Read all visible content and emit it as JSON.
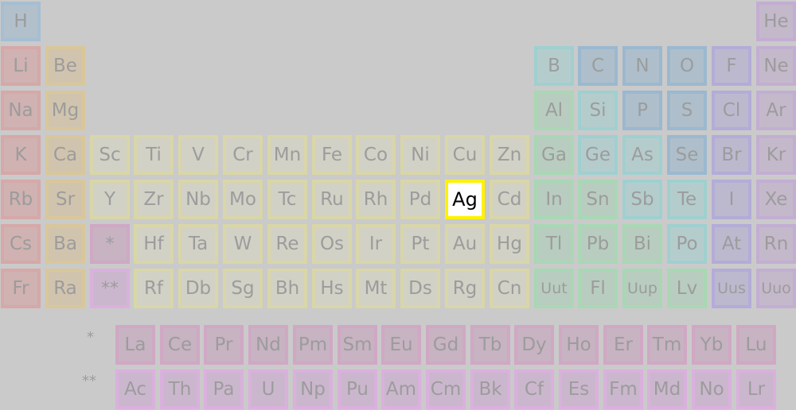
{
  "title": "",
  "selected": "Ag",
  "colors": {
    "background": "#cacaca",
    "text": "#9c9c9c",
    "selected_bg": "#ffffff",
    "selected_border": "#fff200",
    "selected_text": "#000000",
    "families": {
      "alkali": {
        "bg": "#cfb2b1",
        "border": "#d6a8a8"
      },
      "alkaline": {
        "bg": "#d1c4ae",
        "border": "#d9c79a"
      },
      "transition": {
        "bg": "#d1d1c6",
        "border": "#d9d6a8"
      },
      "lanthanide": {
        "bg": "#c7b3c2",
        "border": "#d0a8c4"
      },
      "actinide": {
        "bg": "#cbb7cd",
        "border": "#dab0dd"
      },
      "poor": {
        "bg": "#b8cdbf",
        "border": "#a8d8b4"
      },
      "metalloid": {
        "bg": "#b5cccd",
        "border": "#9fd0d0"
      },
      "nonmetal": {
        "bg": "#aebfcb",
        "border": "#9bb8cf"
      },
      "halogen": {
        "bg": "#bcb9cf",
        "border": "#b3acd8"
      },
      "noble": {
        "bg": "#c4b9ca",
        "border": "#c3aed3"
      },
      "hydrogen": {
        "bg": "#b2c0cb",
        "border": "#a5bed2"
      }
    }
  },
  "markers": [
    "*",
    "**"
  ],
  "rows": [
    [
      {
        "s": "H",
        "f": "hydrogen"
      },
      null,
      null,
      null,
      null,
      null,
      null,
      null,
      null,
      null,
      null,
      null,
      null,
      null,
      null,
      null,
      null,
      {
        "s": "He",
        "f": "noble"
      }
    ],
    [
      {
        "s": "Li",
        "f": "alkali"
      },
      {
        "s": "Be",
        "f": "alkaline"
      },
      null,
      null,
      null,
      null,
      null,
      null,
      null,
      null,
      null,
      null,
      {
        "s": "B",
        "f": "metalloid"
      },
      {
        "s": "C",
        "f": "nonmetal"
      },
      {
        "s": "N",
        "f": "nonmetal"
      },
      {
        "s": "O",
        "f": "nonmetal"
      },
      {
        "s": "F",
        "f": "halogen"
      },
      {
        "s": "Ne",
        "f": "noble"
      }
    ],
    [
      {
        "s": "Na",
        "f": "alkali"
      },
      {
        "s": "Mg",
        "f": "alkaline"
      },
      null,
      null,
      null,
      null,
      null,
      null,
      null,
      null,
      null,
      null,
      {
        "s": "Al",
        "f": "poor"
      },
      {
        "s": "Si",
        "f": "metalloid"
      },
      {
        "s": "P",
        "f": "nonmetal"
      },
      {
        "s": "S",
        "f": "nonmetal"
      },
      {
        "s": "Cl",
        "f": "halogen"
      },
      {
        "s": "Ar",
        "f": "noble"
      }
    ],
    [
      {
        "s": "K",
        "f": "alkali"
      },
      {
        "s": "Ca",
        "f": "alkaline"
      },
      {
        "s": "Sc",
        "f": "transition"
      },
      {
        "s": "Ti",
        "f": "transition"
      },
      {
        "s": "V",
        "f": "transition"
      },
      {
        "s": "Cr",
        "f": "transition"
      },
      {
        "s": "Mn",
        "f": "transition"
      },
      {
        "s": "Fe",
        "f": "transition"
      },
      {
        "s": "Co",
        "f": "transition"
      },
      {
        "s": "Ni",
        "f": "transition"
      },
      {
        "s": "Cu",
        "f": "transition"
      },
      {
        "s": "Zn",
        "f": "transition"
      },
      {
        "s": "Ga",
        "f": "poor"
      },
      {
        "s": "Ge",
        "f": "metalloid"
      },
      {
        "s": "As",
        "f": "metalloid"
      },
      {
        "s": "Se",
        "f": "nonmetal"
      },
      {
        "s": "Br",
        "f": "halogen"
      },
      {
        "s": "Kr",
        "f": "noble"
      }
    ],
    [
      {
        "s": "Rb",
        "f": "alkali"
      },
      {
        "s": "Sr",
        "f": "alkaline"
      },
      {
        "s": "Y",
        "f": "transition"
      },
      {
        "s": "Zr",
        "f": "transition"
      },
      {
        "s": "Nb",
        "f": "transition"
      },
      {
        "s": "Mo",
        "f": "transition"
      },
      {
        "s": "Tc",
        "f": "transition"
      },
      {
        "s": "Ru",
        "f": "transition"
      },
      {
        "s": "Rh",
        "f": "transition"
      },
      {
        "s": "Pd",
        "f": "transition"
      },
      {
        "s": "Ag",
        "f": "transition"
      },
      {
        "s": "Cd",
        "f": "transition"
      },
      {
        "s": "In",
        "f": "poor"
      },
      {
        "s": "Sn",
        "f": "poor"
      },
      {
        "s": "Sb",
        "f": "metalloid"
      },
      {
        "s": "Te",
        "f": "metalloid"
      },
      {
        "s": "I",
        "f": "halogen"
      },
      {
        "s": "Xe",
        "f": "noble"
      }
    ],
    [
      {
        "s": "Cs",
        "f": "alkali"
      },
      {
        "s": "Ba",
        "f": "alkaline"
      },
      {
        "s": "*",
        "f": "lanthanide",
        "mark": true
      },
      {
        "s": "Hf",
        "f": "transition"
      },
      {
        "s": "Ta",
        "f": "transition"
      },
      {
        "s": "W",
        "f": "transition"
      },
      {
        "s": "Re",
        "f": "transition"
      },
      {
        "s": "Os",
        "f": "transition"
      },
      {
        "s": "Ir",
        "f": "transition"
      },
      {
        "s": "Pt",
        "f": "transition"
      },
      {
        "s": "Au",
        "f": "transition"
      },
      {
        "s": "Hg",
        "f": "transition"
      },
      {
        "s": "Tl",
        "f": "poor"
      },
      {
        "s": "Pb",
        "f": "poor"
      },
      {
        "s": "Bi",
        "f": "poor"
      },
      {
        "s": "Po",
        "f": "metalloid"
      },
      {
        "s": "At",
        "f": "halogen"
      },
      {
        "s": "Rn",
        "f": "noble"
      }
    ],
    [
      {
        "s": "Fr",
        "f": "alkali"
      },
      {
        "s": "Ra",
        "f": "alkaline"
      },
      {
        "s": "**",
        "f": "actinide",
        "mark": true
      },
      {
        "s": "Rf",
        "f": "transition"
      },
      {
        "s": "Db",
        "f": "transition"
      },
      {
        "s": "Sg",
        "f": "transition"
      },
      {
        "s": "Bh",
        "f": "transition"
      },
      {
        "s": "Hs",
        "f": "transition"
      },
      {
        "s": "Mt",
        "f": "transition"
      },
      {
        "s": "Ds",
        "f": "transition"
      },
      {
        "s": "Rg",
        "f": "transition"
      },
      {
        "s": "Cn",
        "f": "transition"
      },
      {
        "s": "Uut",
        "f": "poor",
        "small": true
      },
      {
        "s": "Fl",
        "f": "poor"
      },
      {
        "s": "Uup",
        "f": "poor",
        "small": true
      },
      {
        "s": "Lv",
        "f": "poor"
      },
      {
        "s": "Uus",
        "f": "halogen",
        "small": true
      },
      {
        "s": "Uuo",
        "f": "noble",
        "small": true
      }
    ]
  ],
  "lanthanides": [
    "La",
    "Ce",
    "Pr",
    "Nd",
    "Pm",
    "Sm",
    "Eu",
    "Gd",
    "Tb",
    "Dy",
    "Ho",
    "Er",
    "Tm",
    "Yb",
    "Lu"
  ],
  "actinides": [
    "Ac",
    "Th",
    "Pa",
    "U",
    "Np",
    "Pu",
    "Am",
    "Cm",
    "Bk",
    "Cf",
    "Es",
    "Fm",
    "Md",
    "No",
    "Lr"
  ]
}
